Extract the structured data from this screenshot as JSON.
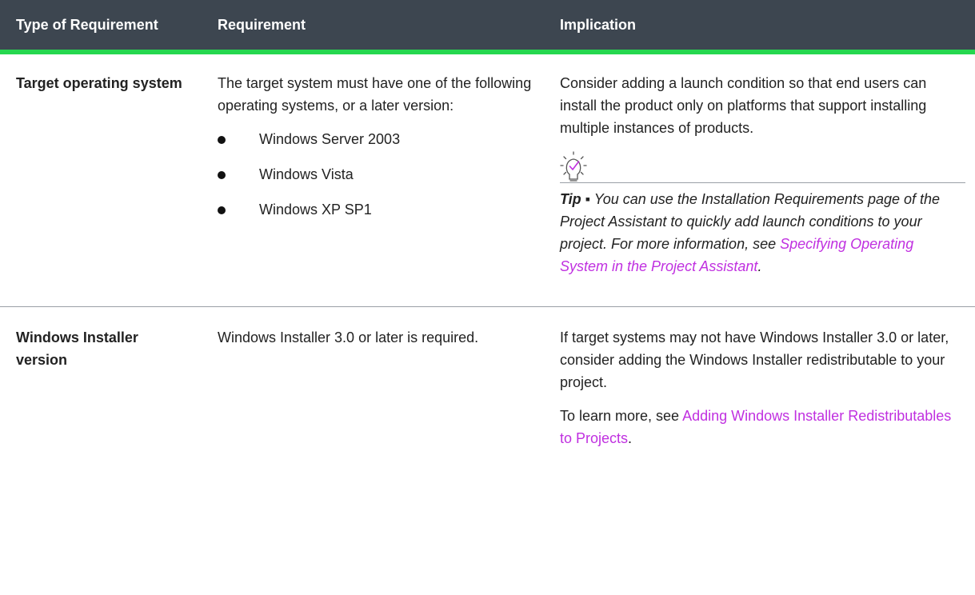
{
  "header": {
    "col_type": "Type of Requirement",
    "col_requirement": "Requirement",
    "col_implication": "Implication"
  },
  "rows": [
    {
      "type": "Target operating system",
      "requirement": {
        "intro": "The target system must have one of the following operating systems, or a later version:",
        "items": [
          "Windows Server 2003",
          "Windows Vista",
          "Windows XP SP1"
        ]
      },
      "implication": {
        "text": "Consider adding a launch condition so that end users can install the product only on platforms that support installing multiple instances of products.",
        "tip_icon": "lightbulb-check-icon",
        "tip_label": "Tip",
        "tip_separator": " ▪ ",
        "tip_text": "You can use the Installation Requirements page of the Project Assistant to quickly add launch conditions to your project. For more information, see ",
        "tip_link": "Specifying Operating System in the Project Assistant",
        "tip_end": "."
      }
    },
    {
      "type": "Windows Installer version",
      "requirement": {
        "text": "Windows Installer 3.0 or later is required."
      },
      "implication": {
        "text": "If target systems may not have Windows Installer 3.0 or later, consider adding the Windows Installer redistributable to your project.",
        "learn_more_prefix": "To learn more, see ",
        "learn_more_link": "Adding Windows Installer Redistributables to Projects",
        "learn_more_end": "."
      }
    }
  ],
  "colors": {
    "header_bg": "#3d4650",
    "header_text": "#ffffff",
    "accent_rule": "#26d74f",
    "link": "#c030e0",
    "tip_icon": "#c030e0"
  }
}
